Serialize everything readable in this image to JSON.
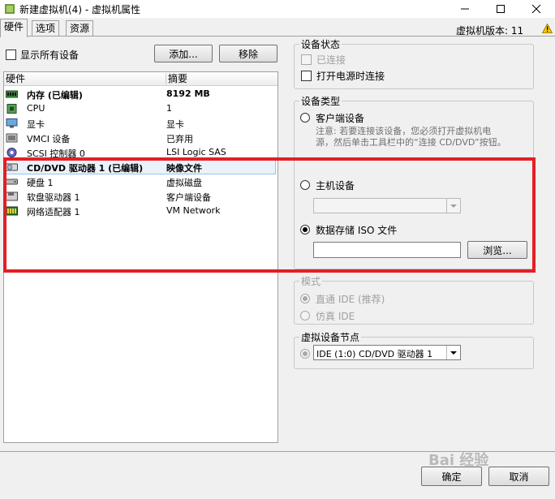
{
  "window": {
    "title": "新建虚拟机(4) - 虚拟机属性",
    "version": "虚拟机版本: 11"
  },
  "tabs": [
    {
      "label": "硬件",
      "active": true
    },
    {
      "label": "选项",
      "active": false
    },
    {
      "label": "资源",
      "active": false
    }
  ],
  "toolbar": {
    "show_all_label": "显示所有设备",
    "add_label": "添加...",
    "remove_label": "移除"
  },
  "hardware_list": {
    "col_hardware": "硬件",
    "col_summary": "摘要",
    "rows": [
      {
        "name": "内存 (已编辑)",
        "summary": "8192 MB",
        "icon": "memory-icon"
      },
      {
        "name": "CPU",
        "summary": "1",
        "icon": "cpu-icon"
      },
      {
        "name": "显卡",
        "summary": "显卡",
        "icon": "display-icon"
      },
      {
        "name": "VMCI 设备",
        "summary": "已弃用",
        "icon": "vmci-icon"
      },
      {
        "name": "SCSI 控制器 0",
        "summary": "LSI Logic SAS",
        "icon": "scsi-icon"
      },
      {
        "name": "CD/DVD 驱动器 1 (已编辑)",
        "summary": "映像文件",
        "icon": "cdrom-icon"
      },
      {
        "name": "硬盘 1",
        "summary": "虚拟磁盘",
        "icon": "disk-icon"
      },
      {
        "name": "软盘驱动器 1",
        "summary": "客户端设备",
        "icon": "floppy-icon"
      },
      {
        "name": "网络适配器 1",
        "summary": "VM Network",
        "icon": "network-icon"
      }
    ]
  },
  "device_status": {
    "title": "设备状态",
    "connected_label": "已连接",
    "connect_at_power_on_label": "打开电源时连接"
  },
  "device_type": {
    "title": "设备类型",
    "client_device_label": "客户端设备",
    "note_line1": "注意: 若要连接该设备，您必须打开虚拟机电",
    "note_line2": "源，然后单击工具栏中的“连接 CD/DVD”按钮。",
    "host_device_label": "主机设备",
    "host_device_value": "",
    "datastore_iso_label": "数据存储 ISO 文件",
    "iso_path_value": "",
    "browse_label": "浏览..."
  },
  "mode": {
    "title": "模式",
    "passthrough_label": "直通 IDE (推荐)",
    "emulate_label": "仿真 IDE"
  },
  "virtual_device_node": {
    "title": "虚拟设备节点",
    "selected": "IDE (1:0) CD/DVD 驱动器 1"
  },
  "footer": {
    "ok_label": "确定",
    "cancel_label": "取消"
  },
  "watermark": "Bai 经验",
  "colors": {
    "highlight_box": "#e41e26",
    "selected_row": "#eaf2fb"
  }
}
